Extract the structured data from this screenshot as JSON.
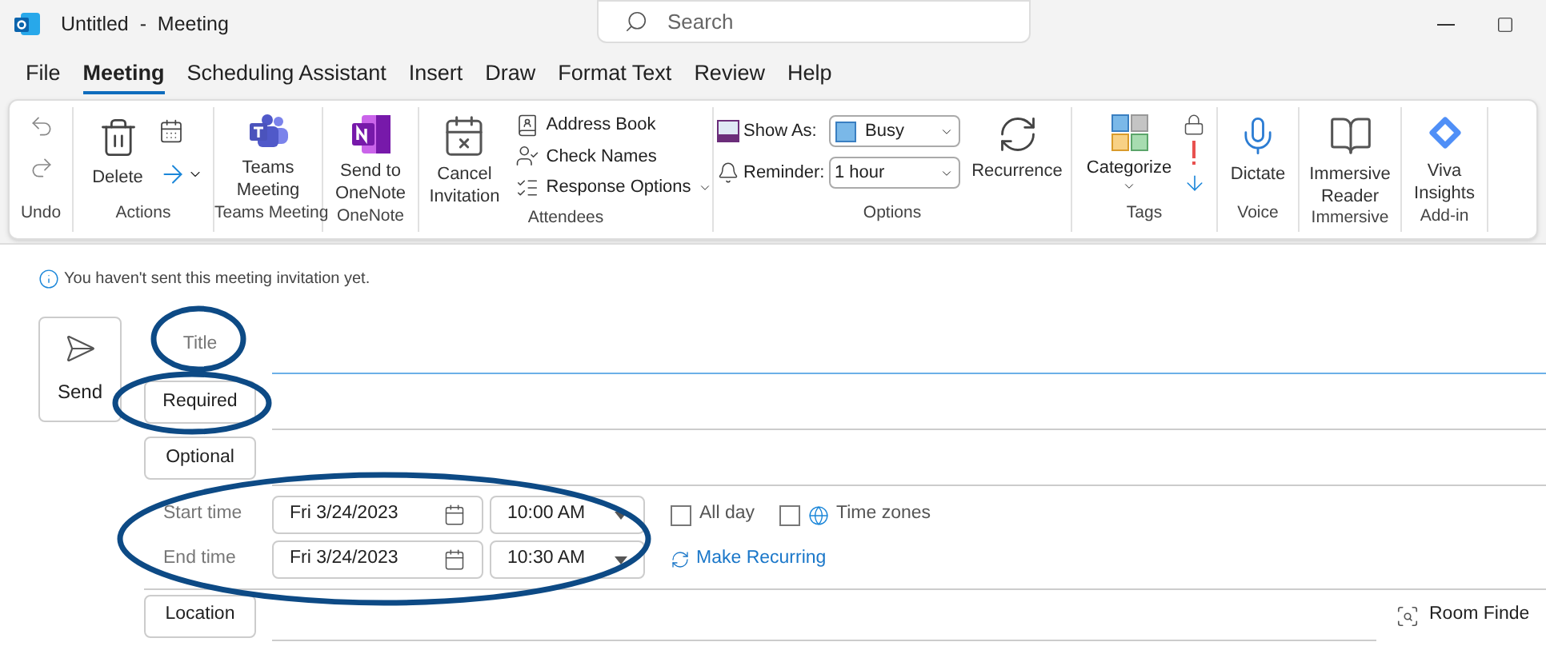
{
  "window": {
    "title": "Untitled  -  Meeting"
  },
  "search": {
    "placeholder": "Search"
  },
  "menu_tabs": [
    {
      "label": "File",
      "selected": false
    },
    {
      "label": "Meeting",
      "selected": true
    },
    {
      "label": "Scheduling Assistant",
      "selected": false
    },
    {
      "label": "Insert",
      "selected": false
    },
    {
      "label": "Draw",
      "selected": false
    },
    {
      "label": "Format Text",
      "selected": false
    },
    {
      "label": "Review",
      "selected": false
    },
    {
      "label": "Help",
      "selected": false
    }
  ],
  "ribbon": {
    "groups": [
      {
        "label": "Undo"
      },
      {
        "label": "Actions",
        "buttons": [
          {
            "label": "Delete"
          }
        ]
      },
      {
        "label": "Teams Meeting",
        "buttons": [
          {
            "label": "Teams Meeting"
          }
        ]
      },
      {
        "label": "OneNote",
        "buttons": [
          {
            "label": "Send to OneNote"
          }
        ]
      },
      {
        "label": "Attendees",
        "buttons": [
          {
            "label": "Cancel Invitation"
          },
          {
            "label": "Address Book"
          },
          {
            "label": "Check Names"
          },
          {
            "label": "Response Options"
          }
        ]
      },
      {
        "label": "Options",
        "show_as": {
          "label": "Show As:",
          "value": "Busy"
        },
        "reminder": {
          "label": "Reminder:",
          "value": "1 hour"
        },
        "buttons": [
          {
            "label": "Recurrence"
          }
        ]
      },
      {
        "label": "Tags",
        "buttons": [
          {
            "label": "Categorize"
          }
        ]
      },
      {
        "label": "Voice",
        "buttons": [
          {
            "label": "Dictate"
          }
        ]
      },
      {
        "label": "Immersive",
        "buttons": [
          {
            "label": "Immersive Reader"
          }
        ]
      },
      {
        "label": "Add-in",
        "buttons": [
          {
            "label": "Viva Insights"
          }
        ]
      }
    ]
  },
  "form": {
    "notice": "You haven't sent this meeting invitation yet.",
    "send": "Send",
    "title": {
      "label": "Title"
    },
    "required": "Required",
    "optional": "Optional",
    "start": {
      "label": "Start time",
      "date": "Fri 3/24/2023",
      "time": "10:00 AM"
    },
    "end": {
      "label": "End time",
      "date": "Fri 3/24/2023",
      "time": "10:30 AM"
    },
    "all_day": {
      "label": "All day",
      "checked": false
    },
    "time_zones": {
      "label": "Time zones",
      "checked": false
    },
    "make_recurring": "Make Recurring",
    "location": "Location",
    "room_finder": "Room Finde"
  }
}
